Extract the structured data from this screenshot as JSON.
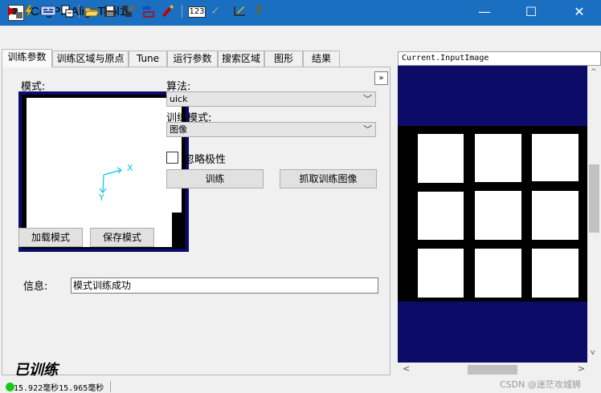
{
  "window": {
    "title": "CogPMAlignTool1",
    "minimize_glyph": "—",
    "maximize_glyph": "☐",
    "close_glyph": "✕",
    "accent": "#1a6fc0"
  },
  "toolbar": {
    "icons": [
      "run-icon",
      "electric-icon",
      "display-icon",
      "copy-icon",
      "open-folder-icon",
      "save-icon",
      "network-icon",
      "import-icon",
      "reset-icon",
      "numeric-icon",
      "check-icon",
      "ruler-icon",
      "help-icon"
    ],
    "numeric_label": "123",
    "help_glyph": "?"
  },
  "tabs": [
    "训练参数",
    "训练区域与原点",
    "Tune",
    "运行参数",
    "搜索区域",
    "图形",
    "结果"
  ],
  "train_params": {
    "model_label": "模式:",
    "load_model_button": "加载模式",
    "save_model_button": "保存模式",
    "algorithm_label": "算法:",
    "algorithm_value": "uick",
    "train_mode_label": "训练模式:",
    "train_mode_value": "图像",
    "ignore_polarity_label": "忽略极性",
    "ignore_polarity_checked": false,
    "train_button": "训练",
    "grab_train_image_button": "抓取训练图像",
    "info_label": "信息:",
    "info_value": "模式训练成功",
    "expand_glyph": "»",
    "axis_x": "X",
    "axis_y": "Y"
  },
  "image_pane": {
    "title": "Current.InputImage",
    "scroll_left": "<",
    "scroll_right": ">",
    "scroll_up": "^",
    "scroll_down": "v"
  },
  "status": {
    "trained_text": "已训练",
    "time_text": "15.922毫秒15.965毫秒",
    "led_color": "#18c818"
  },
  "watermark": "CSDN @迷茫攻城狮"
}
